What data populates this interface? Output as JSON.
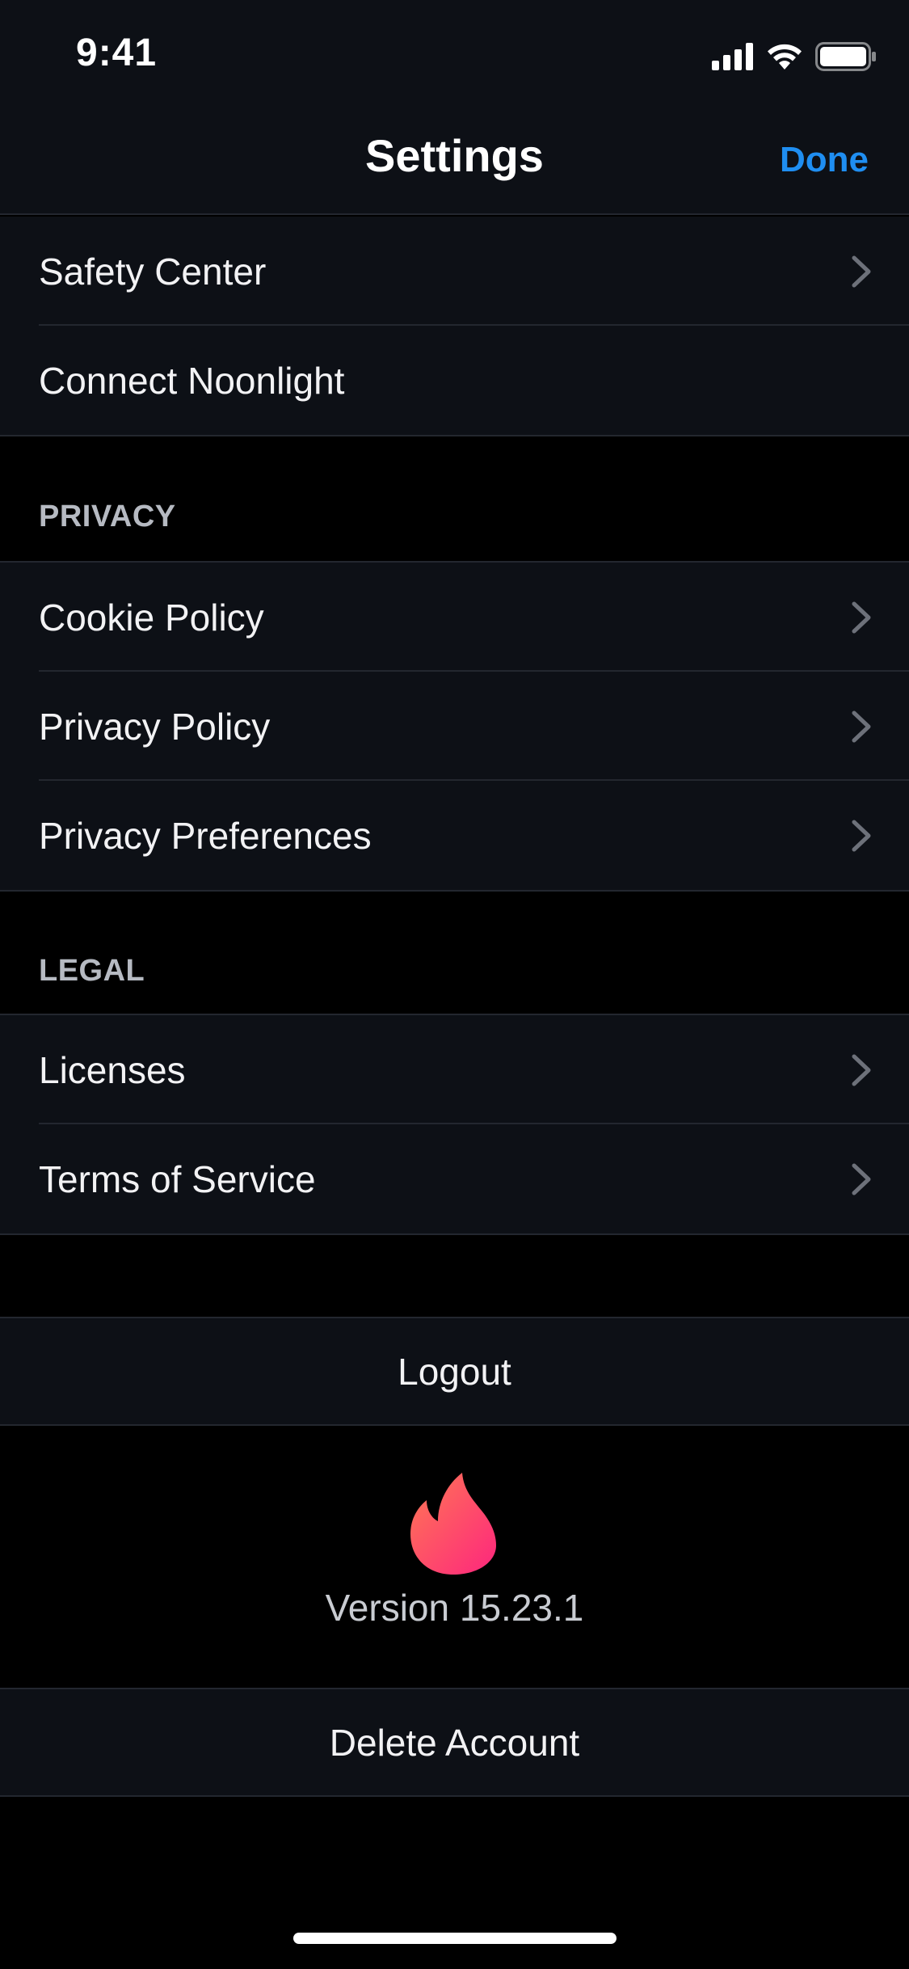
{
  "status_bar": {
    "time": "9:41",
    "icons": [
      "cellular-signal-icon",
      "wifi-icon",
      "battery-icon"
    ]
  },
  "nav": {
    "title": "Settings",
    "done_label": "Done"
  },
  "colors": {
    "accent": "#1f8ef1",
    "background": "#000000",
    "surface": "#0d1016",
    "brand_flame_top": "#ff7854",
    "brand_flame_bottom": "#fd267d"
  },
  "safety": {
    "items": [
      {
        "label": "Safety Center",
        "has_chevron": true
      },
      {
        "label": "Connect Noonlight",
        "has_chevron": false
      }
    ]
  },
  "privacy": {
    "header": "PRIVACY",
    "items": [
      {
        "label": "Cookie Policy"
      },
      {
        "label": "Privacy Policy"
      },
      {
        "label": "Privacy Preferences"
      }
    ]
  },
  "legal": {
    "header": "LEGAL",
    "items": [
      {
        "label": "Licenses"
      },
      {
        "label": "Terms of Service"
      }
    ]
  },
  "logout_label": "Logout",
  "brand_icon": "flame-logo-icon",
  "version_text": "Version 15.23.1",
  "delete_account_label": "Delete Account"
}
